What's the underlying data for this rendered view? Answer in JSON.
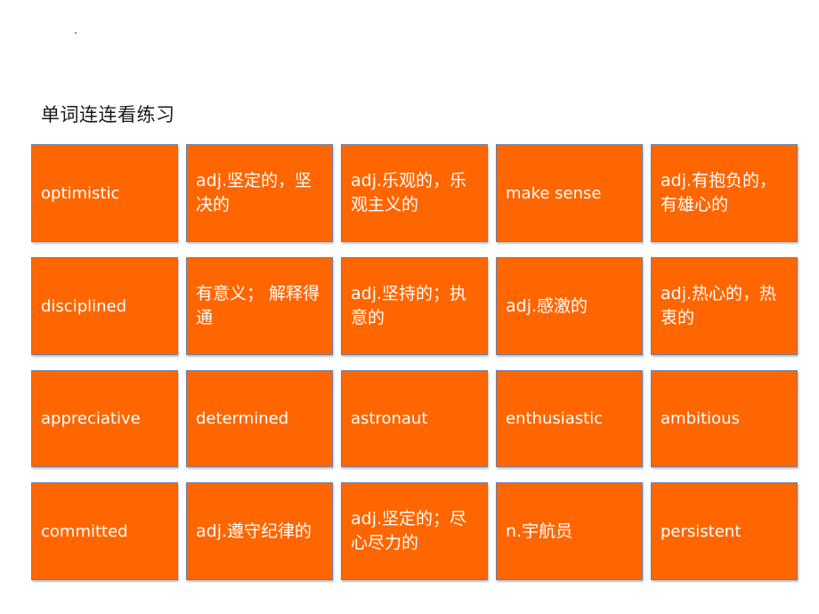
{
  "slide": {
    "title": "单词连连看练习",
    "colors": {
      "card_fill": "#ff6600",
      "card_border": "#6b7fa6",
      "card_text": "#ffffff",
      "title_text": "#1a1a1a",
      "background": "#ffffff"
    },
    "rows": [
      {
        "cards": [
          {
            "text": "optimistic",
            "lang": "en"
          },
          {
            "text": "adj.坚定的，坚决的",
            "lang": "zh"
          },
          {
            "text": "adj.乐观的，乐观主义的",
            "lang": "zh"
          },
          {
            "text": "make sense",
            "lang": "en"
          },
          {
            "text": "adj.有抱负的，有雄心的",
            "lang": "zh"
          }
        ]
      },
      {
        "cards": [
          {
            "text": "disciplined",
            "lang": "en"
          },
          {
            "text": "有意义； 解释得通",
            "lang": "zh"
          },
          {
            "text": "adj.坚持的；执意的",
            "lang": "zh"
          },
          {
            "text": "adj.感激的",
            "lang": "zh"
          },
          {
            "text": "adj.热心的，热衷的",
            "lang": "zh"
          }
        ]
      },
      {
        "cards": [
          {
            "text": "appreciative",
            "lang": "en"
          },
          {
            "text": "determined",
            "lang": "en"
          },
          {
            "text": "astronaut",
            "lang": "en"
          },
          {
            "text": "enthusiastic",
            "lang": "en"
          },
          {
            "text": "ambitious",
            "lang": "en"
          }
        ]
      },
      {
        "cards": [
          {
            "text": "committed",
            "lang": "en"
          },
          {
            "text": "adj.遵守纪律的",
            "lang": "zh"
          },
          {
            "text": "adj.坚定的；尽心尽力的",
            "lang": "zh"
          },
          {
            "text": "n.宇航员",
            "lang": "zh"
          },
          {
            "text": "persistent",
            "lang": "en"
          }
        ]
      }
    ]
  }
}
